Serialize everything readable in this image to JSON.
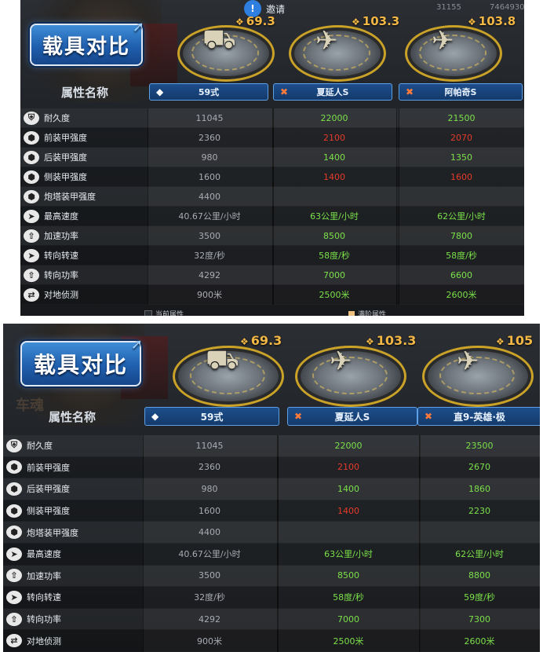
{
  "panels": [
    {
      "invite_label": "邀请",
      "top_numbers": [
        "31155",
        "7464930"
      ],
      "legend": [
        "当前属性",
        "满阶属性"
      ],
      "title": "载具对比",
      "attr_header": "属性名称",
      "vehicles": [
        {
          "power": "69.3",
          "name": "59式",
          "marker": "diamond"
        },
        {
          "power": "103.3",
          "name": "夏延人S",
          "marker": "x"
        },
        {
          "power": "103.8",
          "name": "阿帕奇S",
          "marker": "x"
        }
      ],
      "rows": [
        {
          "label": "耐久度",
          "values": [
            "11045",
            "22000",
            "21500"
          ],
          "colors": [
            "base",
            "green",
            "green"
          ],
          "icon": "shield"
        },
        {
          "label": "前装甲强度",
          "values": [
            "2360",
            "2100",
            "2070"
          ],
          "colors": [
            "base",
            "red",
            "red"
          ],
          "icon": "armor"
        },
        {
          "label": "后装甲强度",
          "values": [
            "980",
            "1400",
            "1350"
          ],
          "colors": [
            "base",
            "green",
            "green"
          ],
          "icon": "armor"
        },
        {
          "label": "侧装甲强度",
          "values": [
            "1600",
            "1400",
            "1600"
          ],
          "colors": [
            "base",
            "red",
            "red"
          ],
          "icon": "armor"
        },
        {
          "label": "炮塔装甲强度",
          "values": [
            "4400",
            "",
            ""
          ],
          "colors": [
            "base",
            "base",
            "base"
          ],
          "icon": "armor"
        },
        {
          "label": "最高速度",
          "values": [
            "40.67公里/小时",
            "63公里/小时",
            "62公里/小时"
          ],
          "colors": [
            "base",
            "green",
            "green"
          ],
          "icon": "speed"
        },
        {
          "label": "加速功率",
          "values": [
            "3500",
            "8500",
            "7800"
          ],
          "colors": [
            "base",
            "green",
            "green"
          ],
          "icon": "power"
        },
        {
          "label": "转向转速",
          "values": [
            "32度/秒",
            "58度/秒",
            "58度/秒"
          ],
          "colors": [
            "base",
            "green",
            "green"
          ],
          "icon": "speed"
        },
        {
          "label": "转向功率",
          "values": [
            "4292",
            "7000",
            "6600"
          ],
          "colors": [
            "base",
            "green",
            "green"
          ],
          "icon": "power"
        },
        {
          "label": "对地侦测",
          "values": [
            "900米",
            "2500米",
            "2600米"
          ],
          "colors": [
            "base",
            "green",
            "green"
          ],
          "icon": "radar"
        }
      ]
    },
    {
      "title": "载具对比",
      "attr_header": "属性名称",
      "watermark": "车魂",
      "vehicles": [
        {
          "power": "69.3",
          "name": "59式",
          "marker": "diamond"
        },
        {
          "power": "103.3",
          "name": "夏延人S",
          "marker": "x"
        },
        {
          "power": "105",
          "name": "直9-英雄·极",
          "marker": "x"
        }
      ],
      "rows": [
        {
          "label": "耐久度",
          "values": [
            "11045",
            "22000",
            "23500"
          ],
          "colors": [
            "base",
            "green",
            "green"
          ],
          "icon": "shield"
        },
        {
          "label": "前装甲强度",
          "values": [
            "2360",
            "2100",
            "2670"
          ],
          "colors": [
            "base",
            "red",
            "green"
          ],
          "icon": "armor"
        },
        {
          "label": "后装甲强度",
          "values": [
            "980",
            "1400",
            "1860"
          ],
          "colors": [
            "base",
            "green",
            "green"
          ],
          "icon": "armor"
        },
        {
          "label": "侧装甲强度",
          "values": [
            "1600",
            "1400",
            "2230"
          ],
          "colors": [
            "base",
            "red",
            "green"
          ],
          "icon": "armor"
        },
        {
          "label": "炮塔装甲强度",
          "values": [
            "4400",
            "",
            ""
          ],
          "colors": [
            "base",
            "base",
            "base"
          ],
          "icon": "armor"
        },
        {
          "label": "最高速度",
          "values": [
            "40.67公里/小时",
            "63公里/小时",
            "62公里/小时"
          ],
          "colors": [
            "base",
            "green",
            "green"
          ],
          "icon": "speed"
        },
        {
          "label": "加速功率",
          "values": [
            "3500",
            "8500",
            "8800"
          ],
          "colors": [
            "base",
            "green",
            "green"
          ],
          "icon": "power"
        },
        {
          "label": "转向转速",
          "values": [
            "32度/秒",
            "58度/秒",
            "59度/秒"
          ],
          "colors": [
            "base",
            "green",
            "green"
          ],
          "icon": "speed"
        },
        {
          "label": "转向功率",
          "values": [
            "4292",
            "7000",
            "7300"
          ],
          "colors": [
            "base",
            "green",
            "green"
          ],
          "icon": "power"
        },
        {
          "label": "对地侦测",
          "values": [
            "900米",
            "2500米",
            "2600米"
          ],
          "colors": [
            "base",
            "green",
            "green"
          ],
          "icon": "radar"
        }
      ]
    }
  ],
  "colors": {
    "green": "#7be04a",
    "red": "#e53a2a",
    "base": "#a8acb2",
    "accent": "#f2b744",
    "title_blue": "#2f75c4"
  }
}
